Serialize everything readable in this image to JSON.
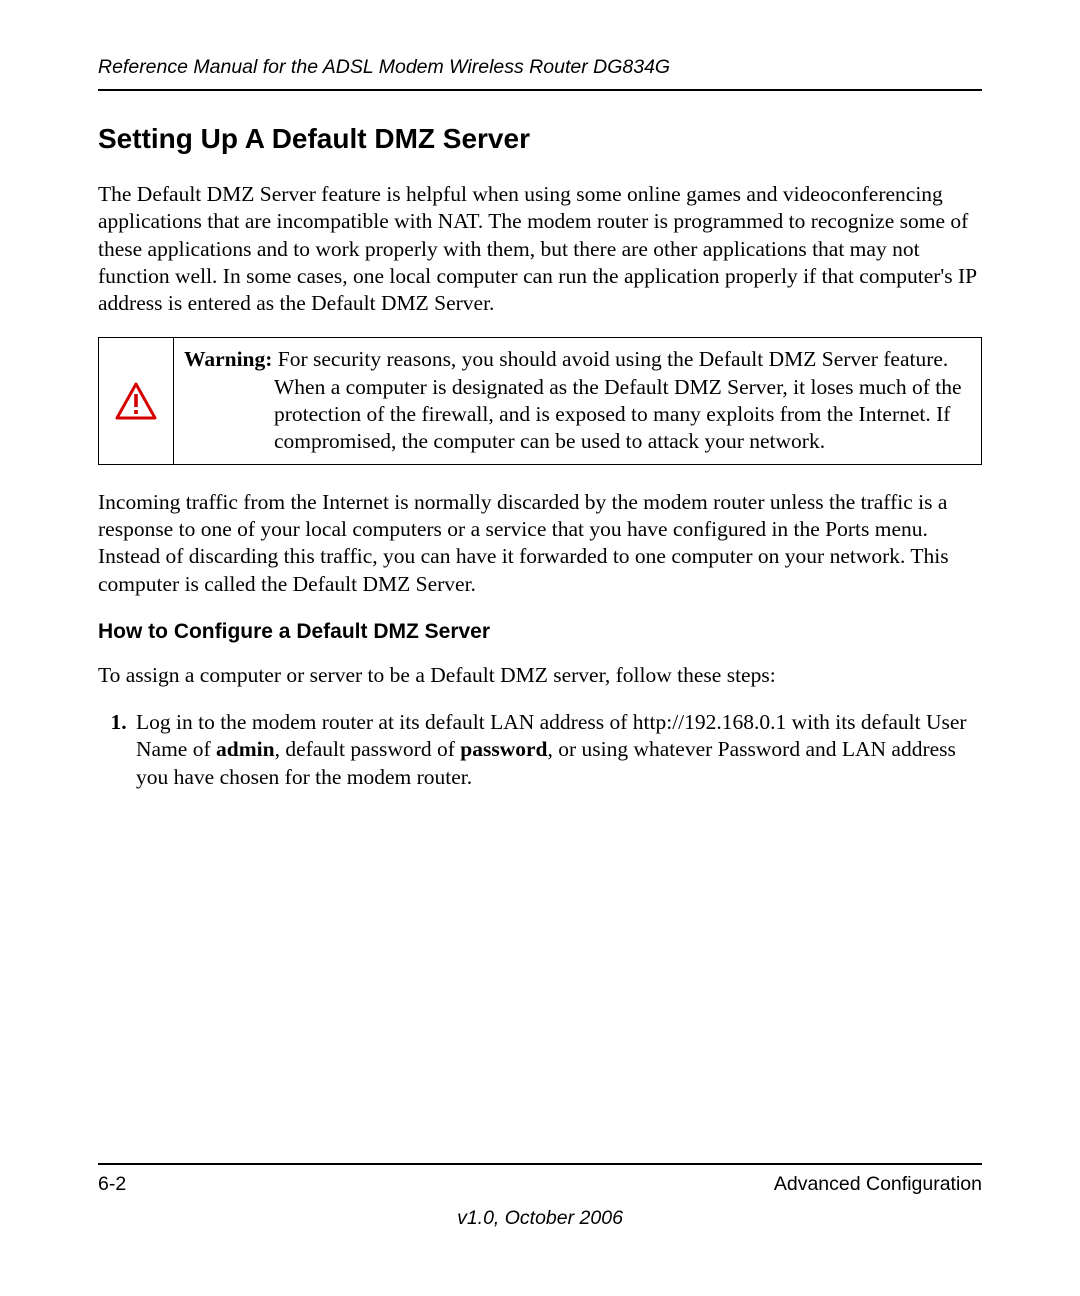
{
  "header": {
    "running_title": "Reference Manual for the ADSL Modem Wireless Router DG834G"
  },
  "section": {
    "title": "Setting Up A Default DMZ Server",
    "intro": "The Default DMZ Server feature is helpful when using some online games and videoconferencing applications that are incompatible with NAT. The modem router is programmed to recognize some of these applications and to work properly with them, but there are other applications that may not function well. In some cases, one local computer can run the application properly if that computer's IP address is entered as the Default DMZ Server."
  },
  "warning": {
    "label": "Warning:",
    "text": "For security reasons, you should avoid using the Default DMZ Server feature. When a computer is designated as the Default DMZ Server, it loses much of the protection of the firewall, and is exposed to many exploits from the Internet. If compromised, the computer can be used to attack your network."
  },
  "post_warning": "Incoming traffic from the Internet is normally discarded by the modem router unless the traffic is a response to one of your local computers or a service that you have configured in the Ports menu. Instead of discarding this traffic, you can have it forwarded to one computer on your network. This computer is called the Default DMZ Server.",
  "subsection": {
    "title": "How to Configure a Default DMZ Server",
    "lead": "To assign a computer or server to be a Default DMZ server, follow these steps:",
    "steps": [
      {
        "pre": "Log in to the modem router at its default LAN address of http://192.168.0.1 with its default User Name of ",
        "bold1": "admin",
        "mid": ", default password of ",
        "bold2": "password",
        "post": ", or using whatever Password and LAN address you have chosen for the modem router."
      }
    ]
  },
  "footer": {
    "page": "6-2",
    "chapter": "Advanced Configuration",
    "version": "v1.0, October 2006"
  }
}
